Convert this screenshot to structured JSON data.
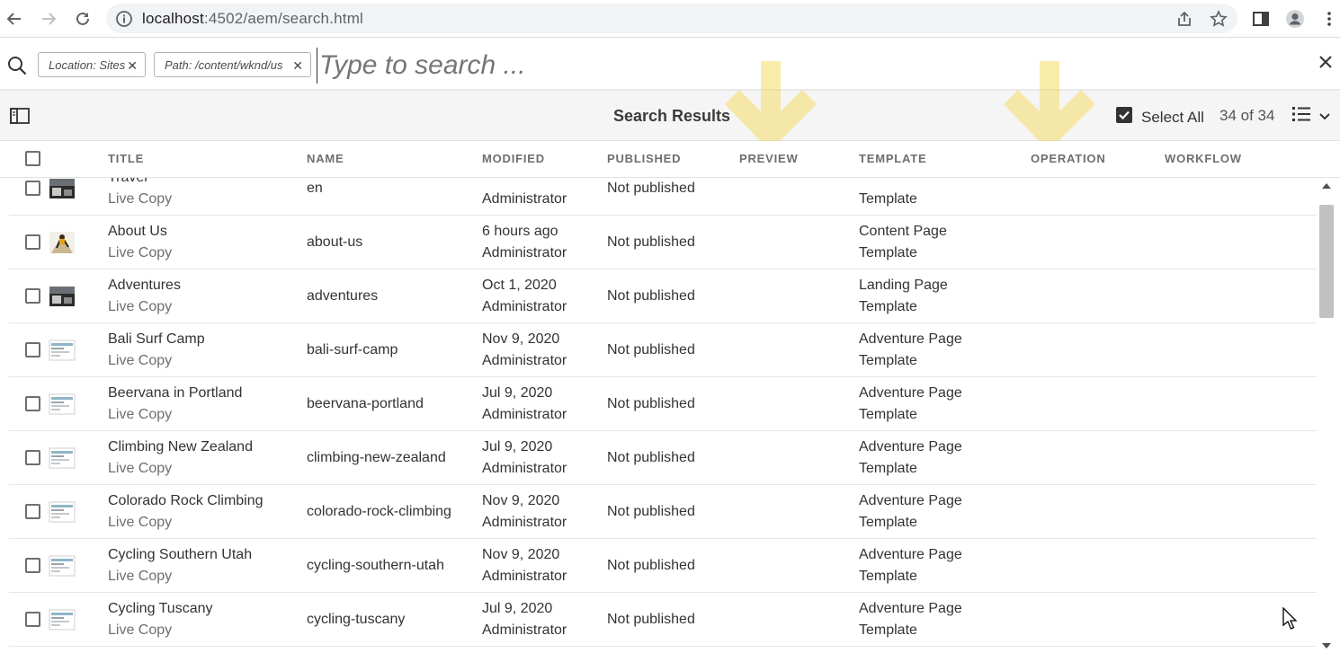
{
  "browser": {
    "url_host": "localhost",
    "url_rest": ":4502/aem/search.html"
  },
  "search": {
    "tags": [
      {
        "label": "Location: Sites"
      },
      {
        "label": "Path: /content/wknd/us"
      }
    ],
    "placeholder": "Type to search ..."
  },
  "actionbar": {
    "title": "Search Results",
    "select_all": "Select All",
    "count": "34 of 34"
  },
  "columns": {
    "title": "TITLE",
    "name": "NAME",
    "modified": "MODIFIED",
    "published": "PUBLISHED",
    "preview": "PREVIEW",
    "template": "TEMPLATE",
    "operation": "OPERATION",
    "workflow": "WORKFLOW"
  },
  "rows": [
    {
      "title": "Travel",
      "subtitle": "Live Copy",
      "name": "en",
      "modified_date": "",
      "modified_by": "Administrator",
      "published": "Not published",
      "template_1": "",
      "template_2": "Template",
      "thumb": "photo-dark"
    },
    {
      "title": "About Us",
      "subtitle": "Live Copy",
      "name": "about-us",
      "modified_date": "6 hours ago",
      "modified_by": "Administrator",
      "published": "Not published",
      "template_1": "Content Page",
      "template_2": "Template",
      "thumb": "photo-climber"
    },
    {
      "title": "Adventures",
      "subtitle": "Live Copy",
      "name": "adventures",
      "modified_date": "Oct 1, 2020",
      "modified_by": "Administrator",
      "published": "Not published",
      "template_1": "Landing Page",
      "template_2": "Template",
      "thumb": "photo-dark"
    },
    {
      "title": "Bali Surf Camp",
      "subtitle": "Live Copy",
      "name": "bali-surf-camp",
      "modified_date": "Nov 9, 2020",
      "modified_by": "Administrator",
      "published": "Not published",
      "template_1": "Adventure Page",
      "template_2": "Template",
      "thumb": "page"
    },
    {
      "title": "Beervana in Portland",
      "subtitle": "Live Copy",
      "name": "beervana-portland",
      "modified_date": "Jul 9, 2020",
      "modified_by": "Administrator",
      "published": "Not published",
      "template_1": "Adventure Page",
      "template_2": "Template",
      "thumb": "page"
    },
    {
      "title": "Climbing New Zealand",
      "subtitle": "Live Copy",
      "name": "climbing-new-zealand",
      "modified_date": "Jul 9, 2020",
      "modified_by": "Administrator",
      "published": "Not published",
      "template_1": "Adventure Page",
      "template_2": "Template",
      "thumb": "page"
    },
    {
      "title": "Colorado Rock Climbing",
      "subtitle": "Live Copy",
      "name": "colorado-rock-climbing",
      "modified_date": "Nov 9, 2020",
      "modified_by": "Administrator",
      "published": "Not published",
      "template_1": "Adventure Page",
      "template_2": "Template",
      "thumb": "page"
    },
    {
      "title": "Cycling Southern Utah",
      "subtitle": "Live Copy",
      "name": "cycling-southern-utah",
      "modified_date": "Nov 9, 2020",
      "modified_by": "Administrator",
      "published": "Not published",
      "template_1": "Adventure Page",
      "template_2": "Template",
      "thumb": "page"
    },
    {
      "title": "Cycling Tuscany",
      "subtitle": "Live Copy",
      "name": "cycling-tuscany",
      "modified_date": "Jul 9, 2020",
      "modified_by": "Administrator",
      "published": "Not published",
      "template_1": "Adventure Page",
      "template_2": "Template",
      "thumb": "page"
    }
  ],
  "colors": {
    "highlight_arrow": "#f6d84a",
    "header_text": "#6e6e6e",
    "subtext": "#6e6e6e"
  }
}
